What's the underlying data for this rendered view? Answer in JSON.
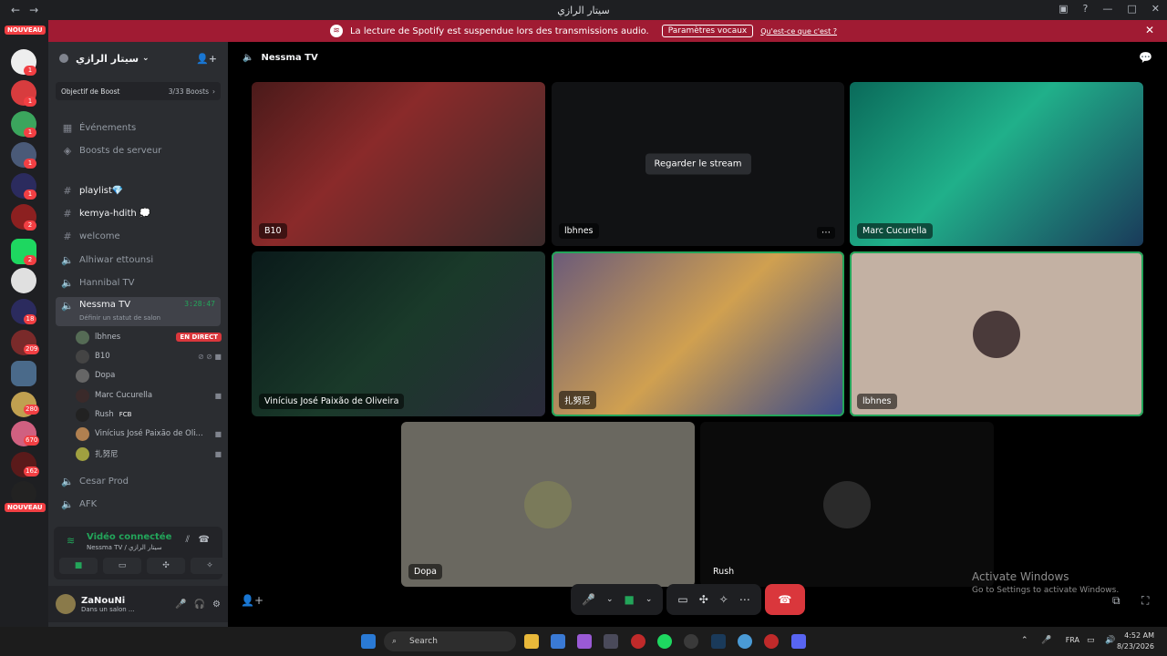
{
  "window": {
    "title": "سيتار الرازي"
  },
  "banner": {
    "message": "La lecture de Spotify est suspendue lors des transmissions audio.",
    "button": "Paramètres vocaux",
    "link": "Qu'est-ce que c'est ?"
  },
  "guilds": {
    "new_label": "NOUVEAU",
    "badges": [
      "1",
      "1",
      "1",
      "1",
      "1",
      "2",
      "2",
      "18",
      "209",
      "280",
      "670",
      "162"
    ]
  },
  "server": {
    "name": "سيتار الرازي",
    "boost_label": "Objectif de Boost",
    "boost_count": "3/33 Boosts",
    "nav": [
      "Événements",
      "Boosts de serveur"
    ],
    "channels": [
      {
        "name": "playlist💎",
        "type": "text"
      },
      {
        "name": "kemya-hdith 💭",
        "type": "text"
      },
      {
        "name": "welcome",
        "type": "text"
      },
      {
        "name": "Alhiwar ettounsi",
        "type": "voice"
      },
      {
        "name": "Hannibal TV",
        "type": "voice"
      }
    ],
    "active_channel": {
      "name": "Nessma TV",
      "timer": "3:28:47",
      "status": "Définir un statut de salon"
    },
    "members": [
      {
        "name": "lbhnes",
        "live": "EN DIRECT"
      },
      {
        "name": "B10"
      },
      {
        "name": "Dopa"
      },
      {
        "name": "Marc Cucurella"
      },
      {
        "name": "Rush",
        "tag": "FCB"
      },
      {
        "name": "Vinícius José Paixão de Oli..."
      },
      {
        "name": "扎努尼"
      }
    ],
    "after_channels": [
      "Cesar Prod",
      "AFK"
    ]
  },
  "voice": {
    "status": "Vidéo connectée",
    "sub": "Nessma TV / سيتار الرازي"
  },
  "user": {
    "name": "ZaNouNi",
    "status": "Dans un salon ..."
  },
  "main": {
    "channel": "Nessma TV",
    "watch_label": "Regarder le stream",
    "tiles": [
      "B10",
      "lbhnes",
      "Marc Cucurella",
      "Vinícius José Paixão de Oliveira",
      "扎努尼",
      "lbhnes",
      "Dopa",
      "Rush"
    ]
  },
  "activation": {
    "title": "Activate Windows",
    "sub": "Go to Settings to activate Windows."
  },
  "taskbar": {
    "search": "Search",
    "lang": "FRA",
    "time": "4:52 AM",
    "date": "8/23/2026"
  }
}
